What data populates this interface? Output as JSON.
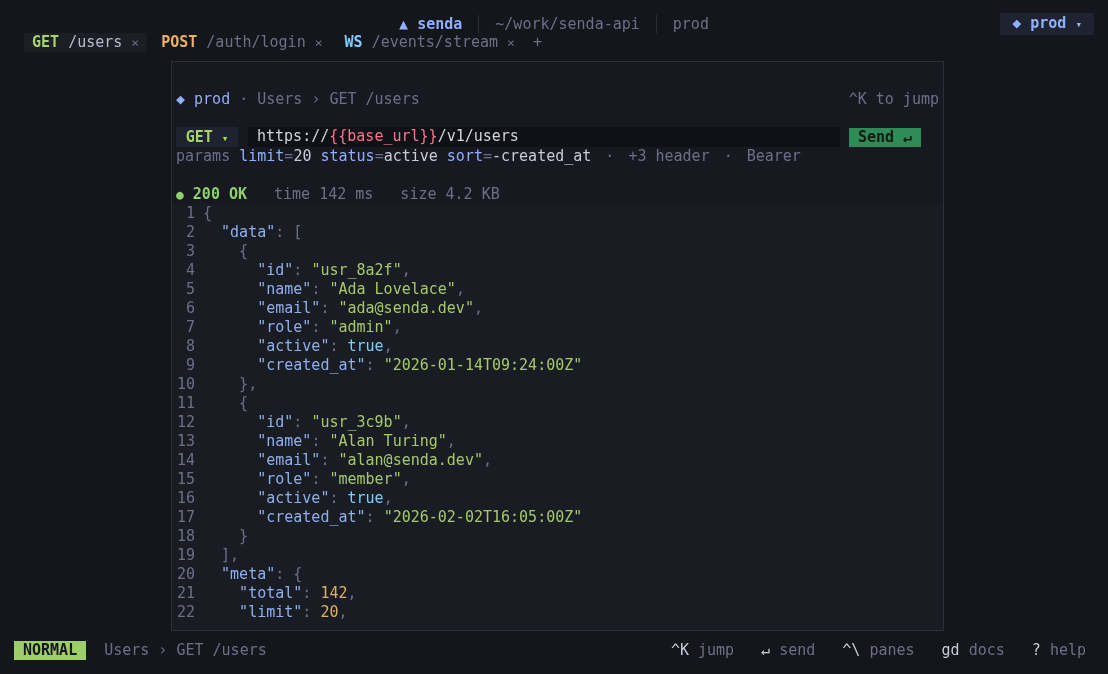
{
  "app": {
    "logo": "▲",
    "name": "senda",
    "path": "~/work/senda-api",
    "env": "prod"
  },
  "env_switcher": {
    "icon": "◆",
    "label": "prod",
    "caret": "▾"
  },
  "tabs": [
    {
      "method": "GET",
      "color": "#a6d36a",
      "path": "/users",
      "close": "×",
      "selected": true
    },
    {
      "method": "POST",
      "color": "#e8b06a",
      "path": "/auth/login",
      "close": "×",
      "selected": false
    },
    {
      "method": "WS",
      "color": "#7dcfff",
      "path": "/events/stream",
      "close": "×",
      "selected": false
    }
  ],
  "new_tab": "+",
  "breadcrumb": [
    {
      "kind": "env",
      "text": "◆ prod"
    },
    {
      "kind": "sep",
      "text": "·"
    },
    {
      "kind": "crumb",
      "text": "Users"
    },
    {
      "kind": "sep",
      "text": "›"
    },
    {
      "kind": "crumb",
      "text": "GET /users"
    }
  ],
  "jump_hint": "^K to jump",
  "request": {
    "method": "GET",
    "caret": "▾",
    "url": [
      {
        "kind": "plain",
        "text": "https://"
      },
      {
        "kind": "var",
        "text": "{{base_url}}"
      },
      {
        "kind": "plain",
        "text": "/v1/users"
      }
    ],
    "send": "Send ↵"
  },
  "params": {
    "label": "params",
    "items": [
      {
        "key": "limit",
        "sep": "=",
        "value": "20"
      },
      {
        "key": "status",
        "sep": "=",
        "value": "active"
      },
      {
        "key": "sort",
        "sep": "=",
        "value": "-created_at"
      }
    ],
    "extras": [
      {
        "kind": "sep",
        "text": "·"
      },
      {
        "kind": "info",
        "text": "+3 header"
      },
      {
        "kind": "sep",
        "text": "·"
      },
      {
        "kind": "info",
        "text": "Bearer"
      }
    ]
  },
  "response": {
    "dot": "●",
    "color": "#8fd16a",
    "status": "200 OK",
    "time": "time 142 ms",
    "size": "size 4.2 KB"
  },
  "code_lines": [
    {
      "number": "1",
      "tokens": [
        {
          "kind": "punct",
          "text": "{"
        }
      ]
    },
    {
      "number": "2",
      "tokens": [
        {
          "kind": "key",
          "text": "  \"data\""
        },
        {
          "kind": "punct",
          "text": ": ["
        }
      ]
    },
    {
      "number": "3",
      "tokens": [
        {
          "kind": "punct",
          "text": "    {"
        }
      ]
    },
    {
      "number": "4",
      "tokens": [
        {
          "kind": "key",
          "text": "      \"id\""
        },
        {
          "kind": "punct",
          "text": ": "
        },
        {
          "kind": "string",
          "text": "\"usr_8a2f\""
        },
        {
          "kind": "punct",
          "text": ","
        }
      ]
    },
    {
      "number": "5",
      "tokens": [
        {
          "kind": "key",
          "text": "      \"name\""
        },
        {
          "kind": "punct",
          "text": ": "
        },
        {
          "kind": "string",
          "text": "\"Ada Lovelace\""
        },
        {
          "kind": "punct",
          "text": ","
        }
      ]
    },
    {
      "number": "6",
      "tokens": [
        {
          "kind": "key",
          "text": "      \"email\""
        },
        {
          "kind": "punct",
          "text": ": "
        },
        {
          "kind": "string",
          "text": "\"ada@senda.dev\""
        },
        {
          "kind": "punct",
          "text": ","
        }
      ]
    },
    {
      "number": "7",
      "tokens": [
        {
          "kind": "key",
          "text": "      \"role\""
        },
        {
          "kind": "punct",
          "text": ": "
        },
        {
          "kind": "string",
          "text": "\"admin\""
        },
        {
          "kind": "punct",
          "text": ","
        }
      ]
    },
    {
      "number": "8",
      "tokens": [
        {
          "kind": "key",
          "text": "      \"active\""
        },
        {
          "kind": "punct",
          "text": ": "
        },
        {
          "kind": "bool",
          "text": "true"
        },
        {
          "kind": "punct",
          "text": ","
        }
      ]
    },
    {
      "number": "9",
      "tokens": [
        {
          "kind": "key",
          "text": "      \"created_at\""
        },
        {
          "kind": "punct",
          "text": ": "
        },
        {
          "kind": "string",
          "text": "\"2026-01-14T09:24:00Z\""
        }
      ]
    },
    {
      "number": "10",
      "tokens": [
        {
          "kind": "punct",
          "text": "    },"
        }
      ]
    },
    {
      "number": "11",
      "tokens": [
        {
          "kind": "punct",
          "text": "    {"
        }
      ]
    },
    {
      "number": "12",
      "tokens": [
        {
          "kind": "key",
          "text": "      \"id\""
        },
        {
          "kind": "punct",
          "text": ": "
        },
        {
          "kind": "string",
          "text": "\"usr_3c9b\""
        },
        {
          "kind": "punct",
          "text": ","
        }
      ]
    },
    {
      "number": "13",
      "tokens": [
        {
          "kind": "key",
          "text": "      \"name\""
        },
        {
          "kind": "punct",
          "text": ": "
        },
        {
          "kind": "string",
          "text": "\"Alan Turing\""
        },
        {
          "kind": "punct",
          "text": ","
        }
      ]
    },
    {
      "number": "14",
      "tokens": [
        {
          "kind": "key",
          "text": "      \"email\""
        },
        {
          "kind": "punct",
          "text": ": "
        },
        {
          "kind": "string",
          "text": "\"alan@senda.dev\""
        },
        {
          "kind": "punct",
          "text": ","
        }
      ]
    },
    {
      "number": "15",
      "tokens": [
        {
          "kind": "key",
          "text": "      \"role\""
        },
        {
          "kind": "punct",
          "text": ": "
        },
        {
          "kind": "string",
          "text": "\"member\""
        },
        {
          "kind": "punct",
          "text": ","
        }
      ]
    },
    {
      "number": "16",
      "tokens": [
        {
          "kind": "key",
          "text": "      \"active\""
        },
        {
          "kind": "punct",
          "text": ": "
        },
        {
          "kind": "bool",
          "text": "true"
        },
        {
          "kind": "punct",
          "text": ","
        }
      ]
    },
    {
      "number": "17",
      "tokens": [
        {
          "kind": "key",
          "text": "      \"created_at\""
        },
        {
          "kind": "punct",
          "text": ": "
        },
        {
          "kind": "string",
          "text": "\"2026-02-02T16:05:00Z\""
        }
      ]
    },
    {
      "number": "18",
      "tokens": [
        {
          "kind": "punct",
          "text": "    }"
        }
      ]
    },
    {
      "number": "19",
      "tokens": [
        {
          "kind": "punct",
          "text": "  ],"
        }
      ]
    },
    {
      "number": "20",
      "tokens": [
        {
          "kind": "key",
          "text": "  \"meta\""
        },
        {
          "kind": "punct",
          "text": ": {"
        }
      ]
    },
    {
      "number": "21",
      "tokens": [
        {
          "kind": "key",
          "text": "    \"total\""
        },
        {
          "kind": "punct",
          "text": ": "
        },
        {
          "kind": "number",
          "text": "142"
        },
        {
          "kind": "punct",
          "text": ","
        }
      ]
    },
    {
      "number": "22",
      "tokens": [
        {
          "kind": "key",
          "text": "    \"limit\""
        },
        {
          "kind": "punct",
          "text": ": "
        },
        {
          "kind": "number",
          "text": "20"
        },
        {
          "kind": "punct",
          "text": ","
        }
      ]
    }
  ],
  "status_bar": {
    "mode": "NORMAL",
    "location": "Users › GET /users",
    "hints": [
      {
        "key": "^K",
        "label": "jump"
      },
      {
        "key": "↵",
        "label": "send"
      },
      {
        "key": "^\\",
        "label": "panes"
      },
      {
        "key": "gd",
        "label": "docs"
      },
      {
        "key": "?",
        "label": "help"
      }
    ]
  }
}
